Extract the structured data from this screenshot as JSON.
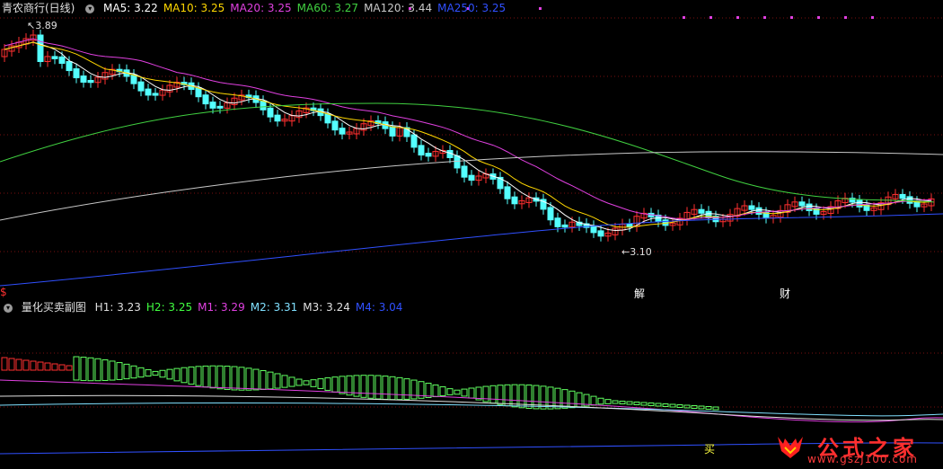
{
  "main": {
    "title": "青农商行(日线)",
    "ma": [
      {
        "label": "MA5: 3.22",
        "color": "#ffffff"
      },
      {
        "label": "MA10: 3.25",
        "color": "#ffd700"
      },
      {
        "label": "MA20: 3.25",
        "color": "#e040e0"
      },
      {
        "label": "MA60: 3.27",
        "color": "#40d040"
      },
      {
        "label": "MA120: 3.44",
        "color": "#c8c8c8"
      },
      {
        "label": "MA250: 3.25",
        "color": "#3050ff"
      }
    ],
    "high_label": "3.89",
    "low_label": "3.10",
    "markers": {
      "left": "$",
      "jie": "解",
      "cai": "财"
    }
  },
  "sub": {
    "title": "量化买卖副图",
    "values": [
      {
        "label": "H1: 3.23",
        "color": "#e0e0e0"
      },
      {
        "label": "H2: 3.25",
        "color": "#40ff40"
      },
      {
        "label": "M1: 3.29",
        "color": "#e040e0"
      },
      {
        "label": "M2: 3.31",
        "color": "#80e0ff"
      },
      {
        "label": "M3: 3.24",
        "color": "#e0e0e0"
      },
      {
        "label": "M4: 3.04",
        "color": "#3050ff"
      }
    ],
    "buy_label": "买"
  },
  "watermark": {
    "text": "公式之家",
    "url": "www.gszj100.com"
  },
  "colors": {
    "up": "#ff3030",
    "down": "#54ffff",
    "background": "#000000"
  }
}
